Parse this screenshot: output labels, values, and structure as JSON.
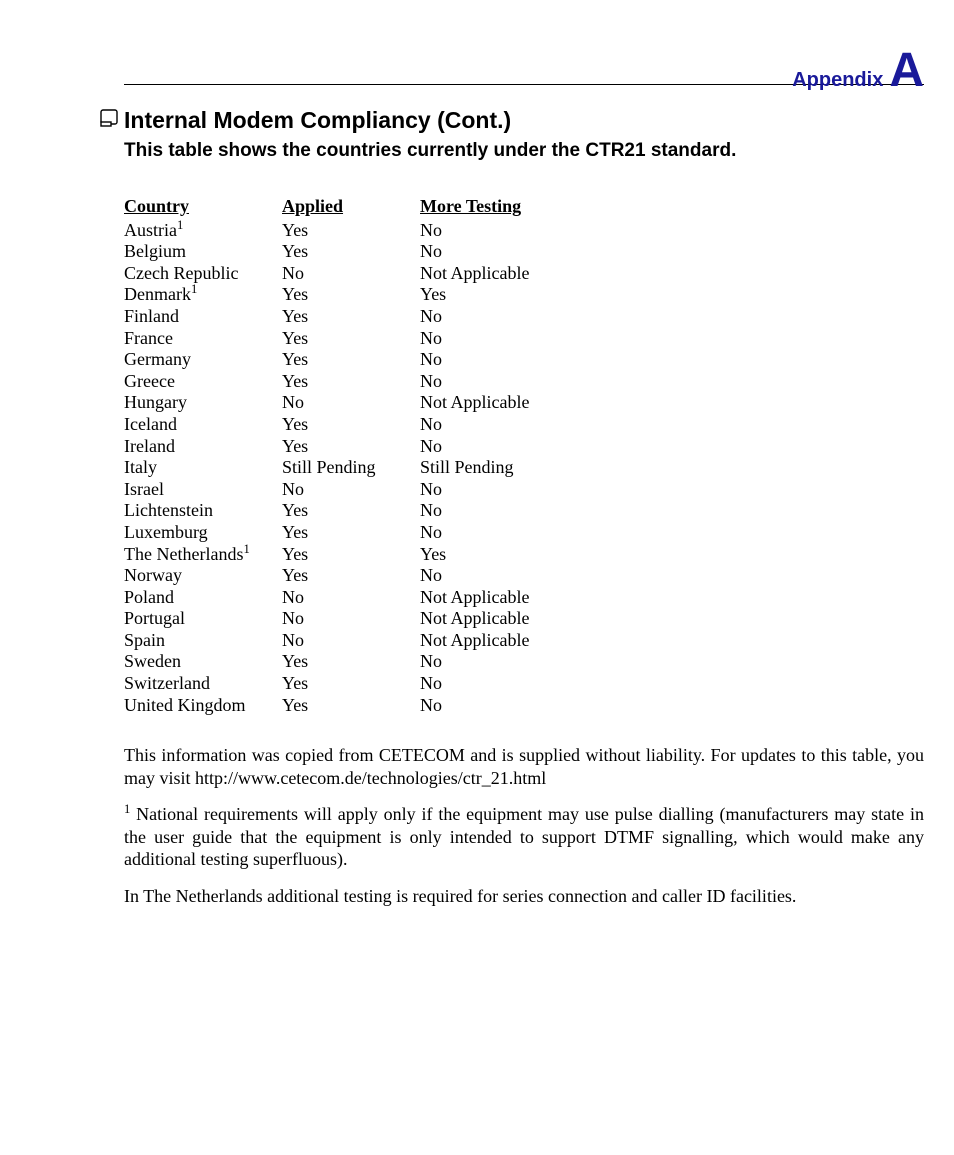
{
  "header": {
    "appendix_word": "Appendix",
    "appendix_letter": "A"
  },
  "title": "Internal Modem Compliancy (Cont.)",
  "subtitle": "This table shows the countries currently under the CTR21 standard.",
  "table": {
    "headers": {
      "country": "Country",
      "applied": "Applied",
      "more": "More Testing"
    },
    "rows": [
      {
        "country": "Austria",
        "sup": "1",
        "applied": "Yes",
        "more": "No"
      },
      {
        "country": "Belgium",
        "sup": "",
        "applied": "Yes",
        "more": "No"
      },
      {
        "country": "Czech Republic",
        "sup": "",
        "applied": "No",
        "more": "Not Applicable"
      },
      {
        "country": "Denmark",
        "sup": "1",
        "applied": "Yes",
        "more": "Yes"
      },
      {
        "country": "Finland",
        "sup": "",
        "applied": "Yes",
        "more": "No"
      },
      {
        "country": "France",
        "sup": "",
        "applied": "Yes",
        "more": "No"
      },
      {
        "country": "Germany",
        "sup": "",
        "applied": "Yes",
        "more": "No"
      },
      {
        "country": "Greece",
        "sup": "",
        "applied": "Yes",
        "more": "No"
      },
      {
        "country": "Hungary",
        "sup": "",
        "applied": "No",
        "more": "Not Applicable"
      },
      {
        "country": "Iceland",
        "sup": "",
        "applied": "Yes",
        "more": "No"
      },
      {
        "country": "Ireland",
        "sup": "",
        "applied": "Yes",
        "more": "No"
      },
      {
        "country": "Italy",
        "sup": "",
        "applied": "Still Pending",
        "more": "Still Pending"
      },
      {
        "country": "Israel",
        "sup": "",
        "applied": "No",
        "more": "No"
      },
      {
        "country": "Lichtenstein",
        "sup": "",
        "applied": "Yes",
        "more": "No"
      },
      {
        "country": "Luxemburg",
        "sup": "",
        "applied": "Yes",
        "more": "No"
      },
      {
        "country": "The Netherlands",
        "sup": "1",
        "applied": "Yes",
        "more": "Yes"
      },
      {
        "country": "Norway",
        "sup": "",
        "applied": "Yes",
        "more": "No"
      },
      {
        "country": "Poland",
        "sup": "",
        "applied": "No",
        "more": "Not Applicable"
      },
      {
        "country": "Portugal",
        "sup": "",
        "applied": "No",
        "more": "Not Applicable"
      },
      {
        "country": "Spain",
        "sup": "",
        "applied": "No",
        "more": "Not Applicable"
      },
      {
        "country": "Sweden",
        "sup": "",
        "applied": "Yes",
        "more": "No"
      },
      {
        "country": "Switzerland",
        "sup": "",
        "applied": "Yes",
        "more": "No"
      },
      {
        "country": "United Kingdom",
        "sup": "",
        "applied": "Yes",
        "more": "No"
      }
    ]
  },
  "paragraphs": {
    "p1": "This information was copied from CETECOM and is supplied without liability. For updates to this table, you may visit http://www.cetecom.de/technologies/ctr_21.html",
    "p2_sup": "1",
    "p2": " National requirements will apply only if the equipment may use pulse dialling (manufacturers may state in the user guide that the equipment is only intended to support DTMF signalling, which would make any additional testing superfluous).",
    "p3": "In The Netherlands additional testing is required for series connection and caller ID facilities."
  }
}
